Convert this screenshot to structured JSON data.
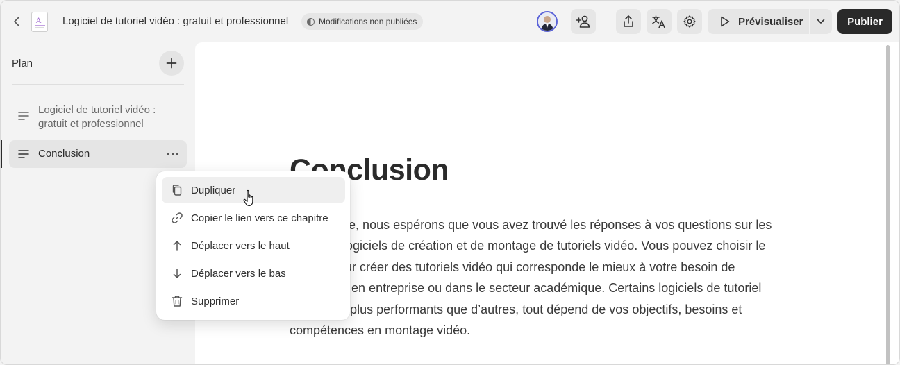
{
  "topbar": {
    "doc_title": "Logiciel de tutoriel vidéo : gratuit et professionnel",
    "status": "Modifications non publiées",
    "preview_label": "Prévisualiser",
    "publish_label": "Publier"
  },
  "sidebar": {
    "heading": "Plan",
    "chapters": [
      {
        "label": "Logiciel de tutoriel vidéo : gratuit et professionnel"
      },
      {
        "label": "Conclusion"
      }
    ]
  },
  "content": {
    "title": "Conclusion",
    "body": "En conclure, nous espérons que vous avez trouvé les réponses à vos questions sur les meilleurs logiciels de création et de montage de tutoriels vidéo. Vous pouvez choisir le logiciel pour créer des tutoriels vidéo qui corresponde le mieux à votre besoin de formations en entreprise ou dans le secteur académique. Certains logiciels de tutoriel vidéo sont plus performants que d’autres, tout dépend de vos objectifs, besoins et compétences en montage vidéo."
  },
  "context_menu": {
    "items": [
      {
        "label": "Dupliquer",
        "icon": "copy-icon"
      },
      {
        "label": "Copier le lien vers ce chapitre",
        "icon": "link-icon"
      },
      {
        "label": "Déplacer vers le haut",
        "icon": "arrow-up-icon"
      },
      {
        "label": "Déplacer vers le bas",
        "icon": "arrow-down-icon"
      },
      {
        "label": "Supprimer",
        "icon": "trash-icon"
      }
    ]
  },
  "colors": {
    "accent_dark": "#2a2a2a",
    "doc_thumb_accent": "#a06ad0",
    "avatar_ring": "#5b63d8"
  }
}
